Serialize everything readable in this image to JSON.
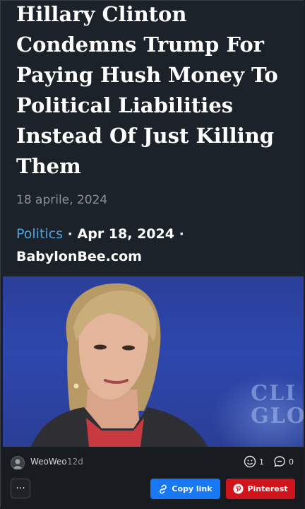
{
  "article": {
    "headline": "Hillary Clinton Condemns Trump For Paying Hush Money To Political Liabilities Instead Of Just Killing Them",
    "date": "18 aprile, 2024",
    "category": "Politics",
    "separator": "·",
    "published": "Apr 18, 2024",
    "source": "BabylonBee.com"
  },
  "image": {
    "watermark_line1": "CLI",
    "watermark_line2": "GLO"
  },
  "post": {
    "username": "WeoWeo",
    "age": "12d",
    "reactions_count": "1",
    "comments_count": "0",
    "more_label": "···",
    "copy_link_label": "Copy link",
    "pinterest_label": "Pinterest"
  },
  "colors": {
    "background": "#1b1f24",
    "category_link": "#4fa3e0",
    "copy_button": "#1877f2",
    "pinterest_button": "#d0141c"
  }
}
